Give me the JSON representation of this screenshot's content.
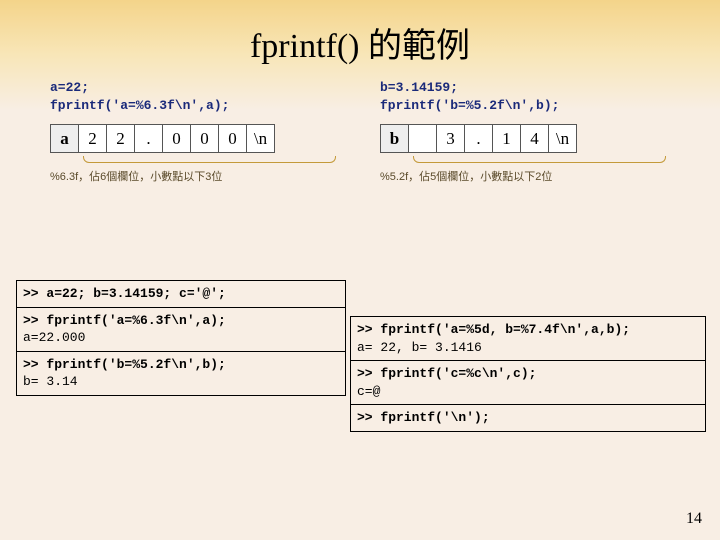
{
  "title": "fprintf() 的範例",
  "left": {
    "src1": "a=22;",
    "src2": "fprintf('a=%6.3f\\n',a);",
    "cells": [
      "a",
      "2",
      "2",
      ".",
      "0",
      "0",
      "0",
      "\\n"
    ],
    "note": "%6.3f，佔6個欄位，小數點以下3位"
  },
  "right": {
    "src1": "b=3.14159;",
    "src2": "fprintf('b=%5.2f\\n',b);",
    "cells": [
      "b",
      " ",
      "3",
      ".",
      "1",
      "4",
      "\\n"
    ],
    "note": "%5.2f，佔5個欄位，小數點以下2位"
  },
  "boxes_left": {
    "b1": ">> a=22; b=3.14159; c='@';",
    "b2a": ">> fprintf('a=%6.3f\\n',a);",
    "b2b": "a=22.000",
    "b3a": ">> fprintf('b=%5.2f\\n',b);",
    "b3b": "b= 3.14"
  },
  "boxes_right": {
    "b1a": ">> fprintf('a=%5d, b=%7.4f\\n',a,b);",
    "b1b": "a=   22, b= 3.1416",
    "b2a": ">> fprintf('c=%c\\n',c);",
    "b2b": "c=@",
    "b3": ">> fprintf('\\n');"
  },
  "slide_num": "14"
}
